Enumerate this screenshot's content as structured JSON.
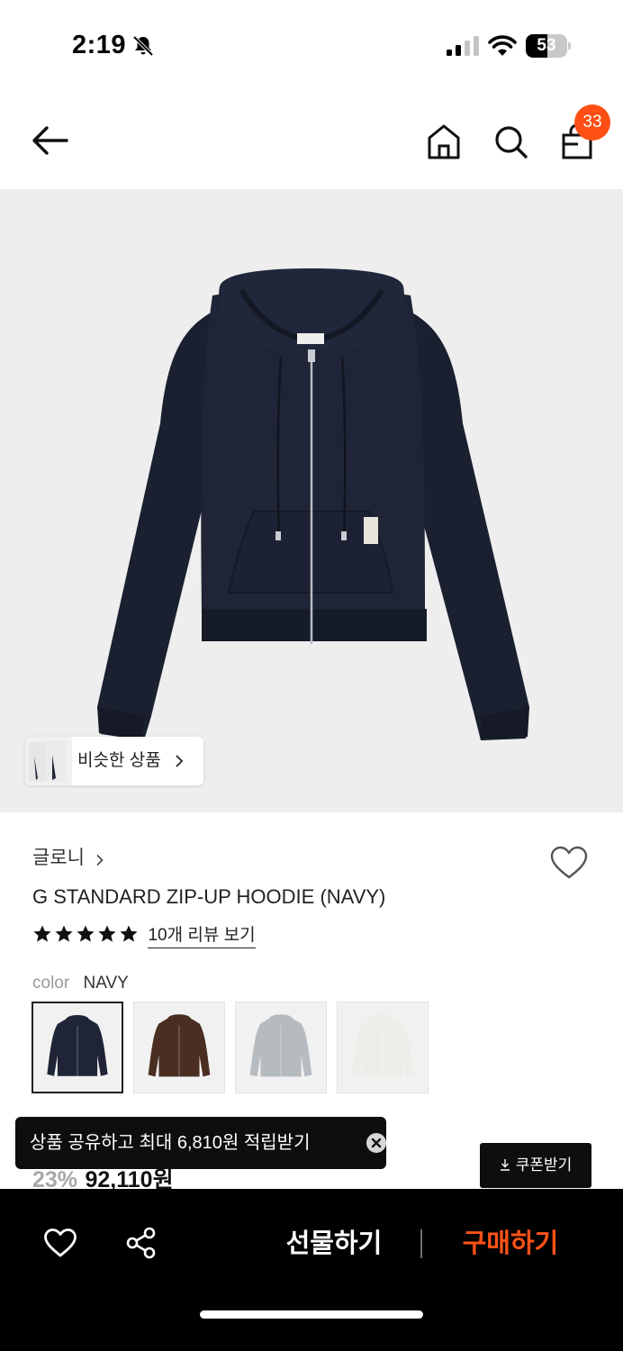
{
  "status_bar": {
    "time": "2:19",
    "battery_level": 53,
    "battery_text": "53",
    "icons": [
      "bell-slash-icon",
      "cellular-signal-icon",
      "wifi-icon",
      "battery-icon"
    ]
  },
  "nav": {
    "icons": [
      "back-arrow-icon",
      "home-icon",
      "search-icon",
      "shopping-bag-icon"
    ],
    "cart_count": "33",
    "badge_color": "#ff4f14"
  },
  "image_overlay": {
    "similar_label": "비슷한 상품",
    "chevron": "chevron-right-icon"
  },
  "product": {
    "brand": "글로니",
    "title": "G STANDARD ZIP-UP HOODIE (NAVY)",
    "rating_stars": 5,
    "review_link": "10개 리뷰 보기",
    "color_label": "color",
    "color_value": "NAVY",
    "swatches": [
      {
        "color": "navy",
        "hex": "#1f2536",
        "selected": true
      },
      {
        "color": "brown",
        "hex": "#4a2e22",
        "selected": false
      },
      {
        "color": "gray",
        "hex": "#b6bbc0",
        "selected": false
      },
      {
        "color": "ivory",
        "hex": "#efede8",
        "selected": false
      }
    ],
    "discount": "23%",
    "price": "92,110원"
  },
  "toast": {
    "message": "상품 공유하고 최대 6,810원 적립받기",
    "close_icon": "close-circle-icon"
  },
  "coupon": {
    "label": "쿠폰받기",
    "icon": "download-icon"
  },
  "bottom_bar": {
    "gift_label": "선물하기",
    "buy_label": "구매하기",
    "buy_color": "#ff5218",
    "icons": [
      "heart-outline-icon",
      "share-icon"
    ]
  }
}
